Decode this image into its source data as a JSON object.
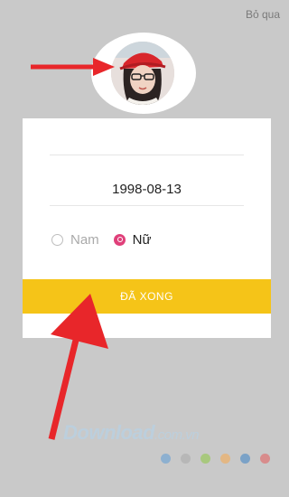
{
  "header": {
    "skip_label": "Bỏ qua"
  },
  "profile": {
    "avatar_alt": "avatar"
  },
  "form": {
    "birthdate": "1998-08-13",
    "gender_male_label": "Nam",
    "gender_female_label": "Nữ",
    "selected_gender": "Nữ",
    "done_label": "ĐÃ XONG"
  },
  "watermark": {
    "brand": "Download",
    "suffix": ".com.vn",
    "dot_colors": [
      "#5b9bd5",
      "#a7a7a7",
      "#8cc63f",
      "#f7a74b",
      "#3b82c4",
      "#e35a5a"
    ]
  },
  "colors": {
    "accent": "#f5c418",
    "radio_selected": "#e0407a",
    "arrow": "#e8262a"
  }
}
